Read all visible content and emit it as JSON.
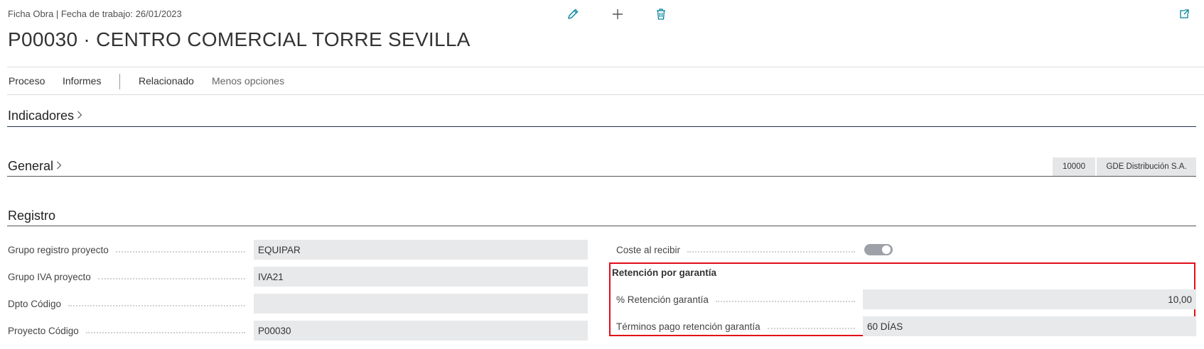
{
  "header": {
    "caption": "Ficha Obra | Fecha de trabajo: 26/01/2023",
    "title": "P00030 · CENTRO COMERCIAL TORRE SEVILLA",
    "actions": [
      {
        "name": "edit-icon",
        "icon": "pencil"
      },
      {
        "name": "new-icon",
        "icon": "plus"
      },
      {
        "name": "delete-icon",
        "icon": "trash"
      },
      {
        "name": "open-new-window-icon",
        "icon": "open-in-new"
      }
    ]
  },
  "menu": {
    "proceso": "Proceso",
    "informes": "Informes",
    "relacionado": "Relacionado",
    "menos_opciones": "Menos opciones"
  },
  "fasttabs": {
    "indicadores": "Indicadores",
    "general": "General",
    "registro": "Registro"
  },
  "general_summary": {
    "code": "10000",
    "name": "GDE Distribución S.A."
  },
  "registro": {
    "left": [
      {
        "label": "Grupo registro proyecto",
        "value": "EQUIPAR"
      },
      {
        "label": "Grupo IVA proyecto",
        "value": "IVA21"
      },
      {
        "label": "Dpto Código",
        "value": ""
      },
      {
        "label": "Proyecto Código",
        "value": "P00030"
      }
    ],
    "coste_al_recibir": {
      "label": "Coste al recibir",
      "on": true
    },
    "retencion": {
      "title": "Retención por garantía",
      "porcentaje": {
        "label": "% Retención garantía",
        "value": "10,00"
      },
      "terminos": {
        "label": "Términos pago retención garantía",
        "value": "60 DÍAS"
      }
    }
  },
  "colors": {
    "accent": "#00829b",
    "highlight_border": "#e30d18",
    "field_bg": "#e8e9eb"
  }
}
